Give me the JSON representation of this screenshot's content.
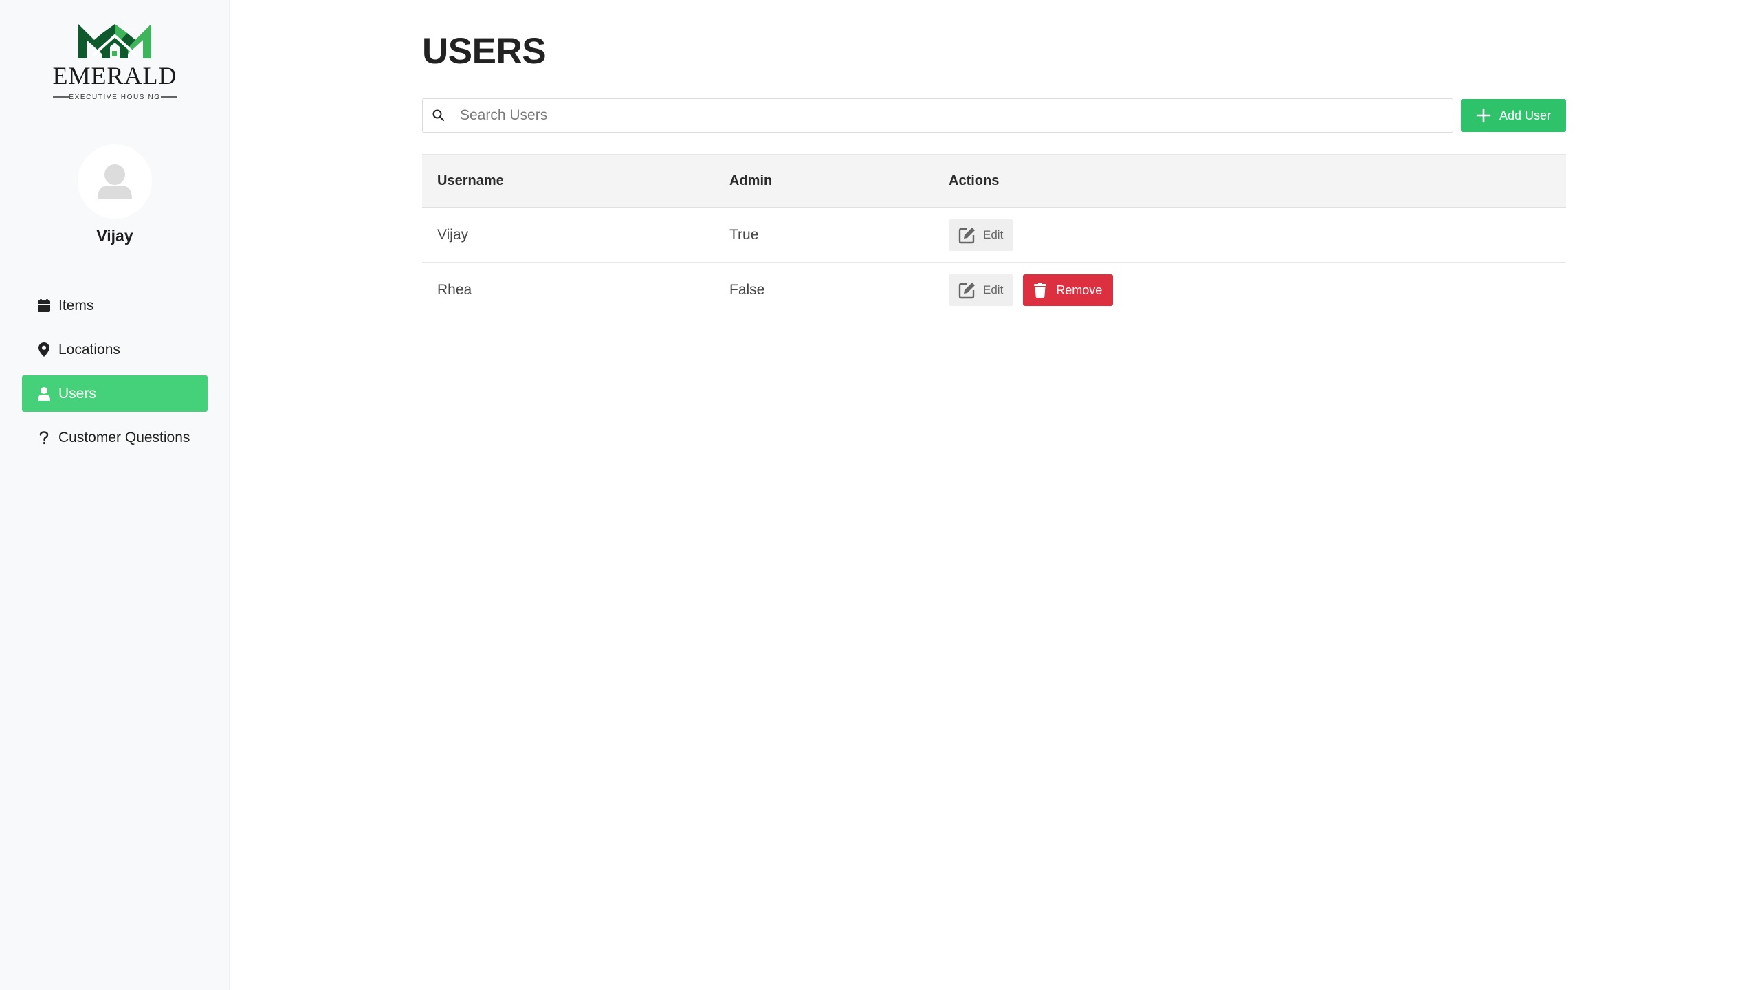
{
  "brand": {
    "name": "EMERALD",
    "tagline": "EXECUTIVE HOUSING",
    "colors": {
      "dark_green": "#0f5a2c",
      "light_green": "#3fb55b"
    }
  },
  "sidebar": {
    "user_name": "Vijay",
    "items": [
      {
        "label": "Items",
        "icon": "calendar-icon",
        "active": false
      },
      {
        "label": "Locations",
        "icon": "map-pin-icon",
        "active": false
      },
      {
        "label": "Users",
        "icon": "user-icon",
        "active": true
      },
      {
        "label": "Customer Questions",
        "icon": "question-icon",
        "active": false
      }
    ]
  },
  "main": {
    "title": "USERS",
    "search": {
      "placeholder": "Search Users",
      "value": ""
    },
    "add_button_label": "Add User",
    "table": {
      "columns": [
        "Username",
        "Admin",
        "Actions"
      ],
      "rows": [
        {
          "username": "Vijay",
          "admin": "True",
          "actions": {
            "edit_label": "Edit"
          }
        },
        {
          "username": "Rhea",
          "admin": "False",
          "actions": {
            "edit_label": "Edit",
            "remove_label": "Remove"
          }
        }
      ]
    }
  },
  "colors": {
    "accent": "#2ec36b",
    "active_nav": "#45d17a",
    "danger": "#dc3040",
    "sidebar_bg": "#f8f9fa"
  }
}
